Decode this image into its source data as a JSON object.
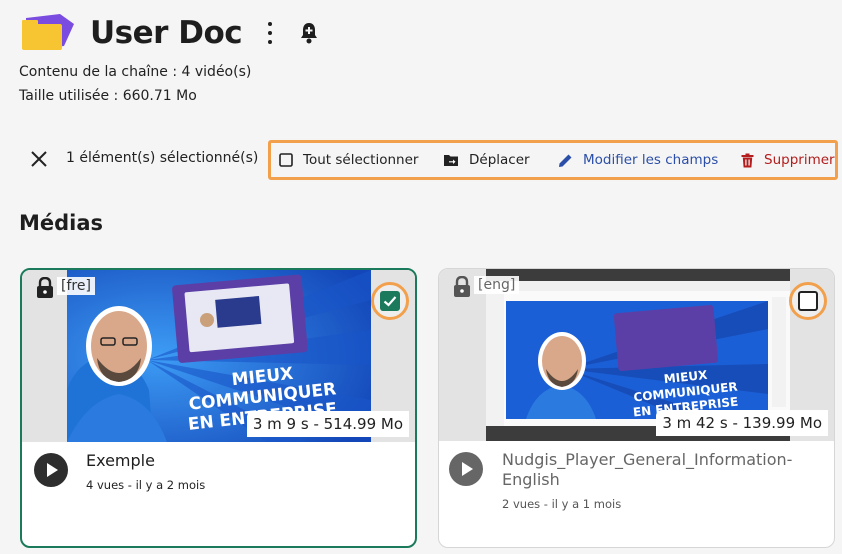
{
  "header": {
    "title": "User Doc",
    "content_label": "Contenu de la chaîne :  4 vidéo(s)",
    "size_label": "Taille utilisée : 660.71 Mo"
  },
  "selection": {
    "count_label": "1 élément(s) sélectionné(s)",
    "select_all": "Tout sélectionner",
    "move": "Déplacer",
    "edit_fields": "Modifier les champs",
    "delete": "Supprimer"
  },
  "section_title": "Médias",
  "colors": {
    "accent_green": "#1b7a5b",
    "highlight_orange": "#f2a04c",
    "edit_blue": "#2b4fa8",
    "delete_red": "#b31d1d"
  },
  "videos": [
    {
      "lang": "[fre]",
      "duration_size": "3 m 9 s - 514.99 Mo",
      "title": "Exemple",
      "meta": "4 vues  - il y a 2 mois",
      "selected": true,
      "thumb_text": "MIEUX COMMUNIQUER EN ENTREPRISE"
    },
    {
      "lang": "[eng]",
      "duration_size": "3 m 42 s - 139.99 Mo",
      "title": "Nudgis_Player_General_Information-English",
      "meta": "2 vues  - il y a 1 mois",
      "selected": false,
      "thumb_text": "MIEUX COMMUNIQUER EN ENTREPRISE"
    }
  ]
}
